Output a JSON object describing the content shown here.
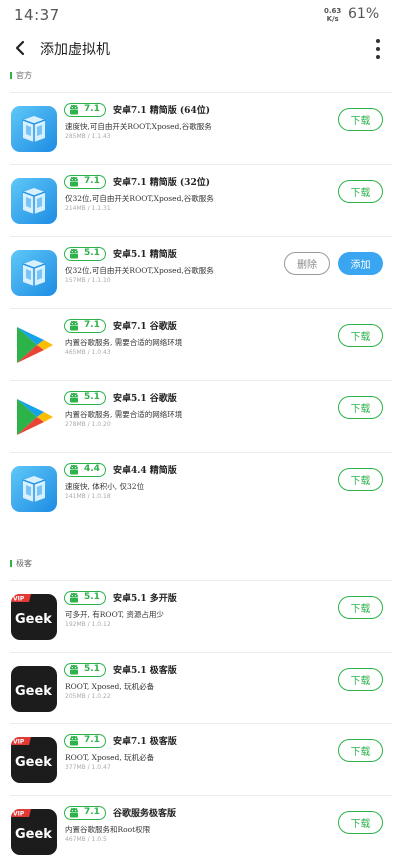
{
  "status": {
    "time": "14:37",
    "speed_value": "0.63",
    "speed_unit": "K/s",
    "battery": "61%"
  },
  "app_bar": {
    "title": "添加虚拟机"
  },
  "sections": {
    "official": {
      "label": "官方",
      "items": [
        {
          "version": "7.1",
          "title": "安卓7.1 精简版 (64位)",
          "desc": "速度快,可自由开关ROOT,Xposed,谷歌服务",
          "meta": "285MB / 1.1.43",
          "action": "下载",
          "icon": "vm-cube-icon"
        },
        {
          "version": "7.1",
          "title": "安卓7.1 精简版 (32位)",
          "desc": "仅32位,可自由开关ROOT,Xposed,谷歌服务",
          "meta": "214MB / 1.1.31",
          "action": "下载",
          "icon": "vm-cube-icon"
        },
        {
          "version": "5.1",
          "title": "安卓5.1 精简版",
          "desc": "仅32位,可自由开关ROOT,Xposed,谷歌服务",
          "meta": "157MB / 1.1.10",
          "delete": "删除",
          "action": "添加",
          "icon": "vm-cube-icon"
        },
        {
          "version": "7.1",
          "title": "安卓7.1 谷歌版",
          "desc": "内置谷歌服务, 需要合适的网络环境",
          "meta": "465MB / 1.0.43",
          "action": "下载",
          "icon": "play-store-icon"
        },
        {
          "version": "5.1",
          "title": "安卓5.1 谷歌版",
          "desc": "内置谷歌服务, 需要合适的网络环境",
          "meta": "278MB / 1.0.20",
          "action": "下载",
          "icon": "play-store-icon"
        },
        {
          "version": "4.4",
          "title": "安卓4.4 精简版",
          "desc": "速度快, 体积小, 仅32位",
          "meta": "141MB / 1.0.18",
          "action": "下载",
          "icon": "vm-cube-icon"
        }
      ]
    },
    "geek": {
      "label": "极客",
      "items": [
        {
          "version": "5.1",
          "title": "安卓5.1 多开版",
          "desc": "可多开, 有ROOT, 资源占用少",
          "meta": "192MB / 1.0.12",
          "action": "下载",
          "icon": "geek-icon",
          "vip": "VIP",
          "logo": "Geek"
        },
        {
          "version": "5.1",
          "title": "安卓5.1 极客版",
          "desc": "ROOT, Xposed, 玩机必备",
          "meta": "205MB / 1.0.22",
          "action": "下载",
          "icon": "geek-icon",
          "vip": "",
          "logo": "Geek"
        },
        {
          "version": "7.1",
          "title": "安卓7.1 极客版",
          "desc": "ROOT, Xposed, 玩机必备",
          "meta": "377MB / 1.0.47",
          "action": "下载",
          "icon": "geek-icon",
          "vip": "VIP",
          "logo": "Geek"
        },
        {
          "version": "7.1",
          "title": "谷歌服务极客版",
          "desc": "内置谷歌服务和Root权限",
          "meta": "467MB / 1.0.5",
          "action": "下载",
          "icon": "geek-icon",
          "vip": "VIP",
          "logo": "Geek"
        }
      ]
    }
  },
  "colors": {
    "accent_green": "#2db34a",
    "accent_blue": "#3aa5f0"
  }
}
